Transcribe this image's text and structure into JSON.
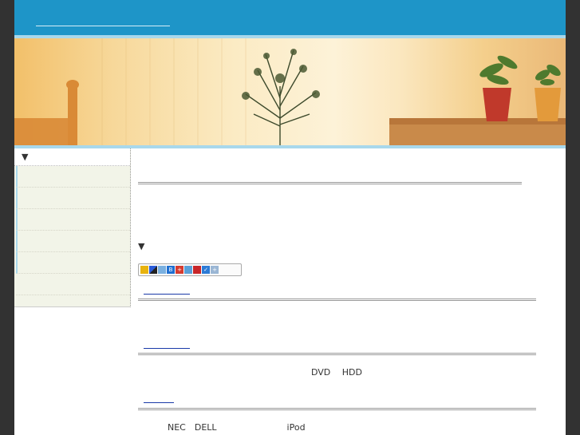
{
  "header": {
    "site_title": ""
  },
  "sidebar": {
    "heading": "▼",
    "items": [
      "",
      "",
      "",
      "",
      "",
      ""
    ]
  },
  "main": {
    "section_marker": "▼",
    "articles": [
      {
        "link": "",
        "text": ""
      },
      {
        "link": "",
        "text": "DVD　 HDD"
      },
      {
        "link": "",
        "text": "NEC　DELL　　　　　　　　iPod"
      }
    ]
  },
  "colors": {
    "header_bg": "#1e95c8",
    "accent_strip": "#a8d8ec",
    "page_bg": "#323232",
    "sidebar_bg": "#f2f4e8",
    "link": "#1a3aa8"
  }
}
